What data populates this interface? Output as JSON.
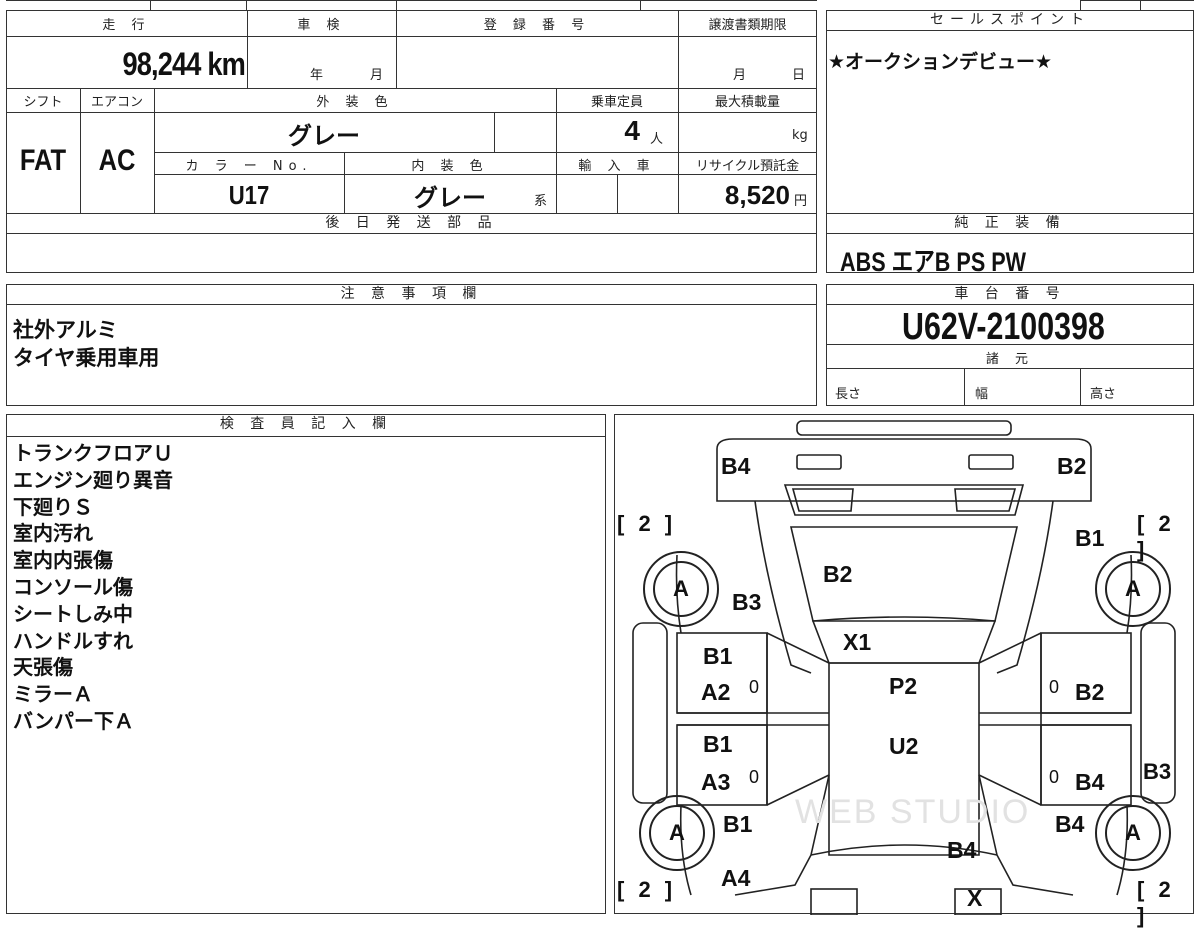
{
  "top": {
    "mileage_label": "走 行",
    "mileage_value": "98,244",
    "mileage_unit": "km",
    "shaken_label": "車 検",
    "shaken_year_unit": "年",
    "shaken_month_unit": "月",
    "reg_label": "登 録 番 号",
    "transfer_label": "譲渡書類期限",
    "transfer_month_unit": "月",
    "transfer_day_unit": "日",
    "shift_label": "シフト",
    "shift_value": "FAT",
    "ac_label": "エアコン",
    "ac_value": "AC",
    "exterior_label": "外 装 色",
    "exterior_value": "グレー",
    "capacity_label": "乗車定員",
    "capacity_value": "4",
    "capacity_unit": "人",
    "maxload_label": "最大積載量",
    "maxload_unit": "kg",
    "color_no_label": "カ ラ ー No.",
    "color_no_value": "U17",
    "interior_label": "内 装 色",
    "interior_value": "グレー",
    "interior_suffix": "系",
    "import_label": "輸 入 車",
    "recycle_label": "リサイクル預託金",
    "recycle_value": "8,520",
    "recycle_unit": "円",
    "later_parts_label": "後 日 発 送 部 品"
  },
  "sales": {
    "label": "セールスポイント",
    "text": "★オークションデビュー★"
  },
  "equipment": {
    "label": "純 正 装 備",
    "text": "ABS エアB PS PW"
  },
  "notes": {
    "label": "注 意 事 項 欄",
    "lines": [
      "社外アルミ",
      "タイヤ乗用車用"
    ]
  },
  "chassis": {
    "label": "車 台 番 号",
    "value": "U62V-2100398",
    "specs_label": "諸 元",
    "length_label": "長さ",
    "width_label": "幅",
    "height_label": "高さ"
  },
  "inspector": {
    "label": "検 査 員 記 入 欄",
    "lines": [
      "トランクフロアＵ",
      "エンジン廻り異音",
      "下廻りＳ",
      "室内汚れ",
      "室内内張傷",
      "コンソール傷",
      "シートしみ中",
      "ハンドルすれ",
      "天張傷",
      "ミラーＡ",
      "バンパー下Ａ"
    ]
  },
  "diagram": {
    "codes": {
      "rear_left": "B4",
      "rear_right": "B2",
      "rear_right_quarter": "B1",
      "rear_left_quarter": "B3",
      "roof": "B2",
      "roof_front": "X1",
      "left_rear_door_top": "B1",
      "left_rear_door_bottom": "A2",
      "left_front_door_top": "B1",
      "left_front_door_bottom": "A3",
      "left_front_fender": "B1",
      "left_front_bottom": "A4",
      "center_upper": "P2",
      "center_lower": "U2",
      "right_rear_door": "B2",
      "right_front_door": "B4",
      "right_rocker": "B3",
      "right_front_fender": "B4",
      "hood": "B4",
      "front": "X"
    },
    "tire_grade": "A",
    "tread": "[ 2 ]",
    "zero": "0",
    "watermark": "WEB STUDIO"
  }
}
